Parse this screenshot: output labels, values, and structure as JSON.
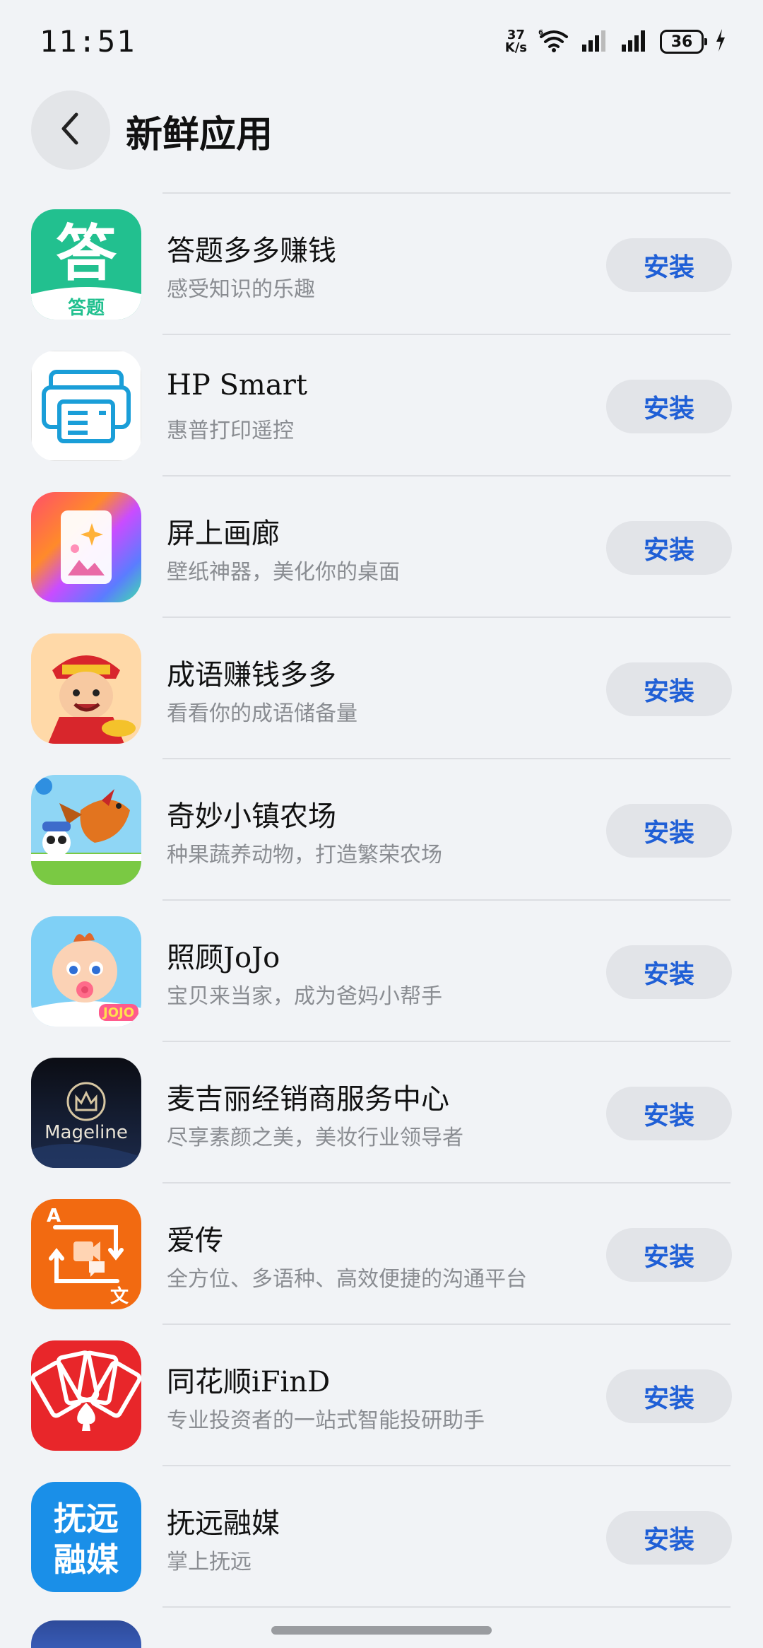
{
  "status_bar": {
    "time": "11:51",
    "net_speed_value": "37",
    "net_speed_unit": "K/s",
    "battery_level": "36"
  },
  "header": {
    "title": "新鲜应用"
  },
  "apps": [
    {
      "name": "答题多多赚钱",
      "desc": "感受知识的乐趣",
      "action": "安装",
      "icon": "quiz-app-icon",
      "icon_text": "答题"
    },
    {
      "name": "HP Smart",
      "desc": "惠普打印遥控",
      "action": "安装",
      "icon": "printer-app-icon"
    },
    {
      "name": "屏上画廊",
      "desc": "壁纸神器，美化你的桌面",
      "action": "安装",
      "icon": "gallery-app-icon"
    },
    {
      "name": "成语赚钱多多",
      "desc": "看看你的成语储备量",
      "action": "安装",
      "icon": "idiom-app-icon"
    },
    {
      "name": "奇妙小镇农场",
      "desc": "种果蔬养动物，打造繁荣农场",
      "action": "安装",
      "icon": "farm-app-icon"
    },
    {
      "name": "照顾JoJo",
      "desc": "宝贝来当家，成为爸妈小帮手",
      "action": "安装",
      "icon": "baby-app-icon",
      "icon_text": "JOJO"
    },
    {
      "name": "麦吉丽经销商服务中心",
      "desc": "尽享素颜之美，美妆行业领导者",
      "action": "安装",
      "icon": "mageline-app-icon",
      "icon_text": "Mageline"
    },
    {
      "name": "爱传",
      "desc": "全方位、多语种、高效便捷的沟通平台",
      "action": "安装",
      "icon": "translate-app-icon",
      "icon_text_a": "A",
      "icon_text_b": "文"
    },
    {
      "name": "同花顺iFinD",
      "desc": "专业投资者的一站式智能投研助手",
      "action": "安装",
      "icon": "cards-app-icon"
    },
    {
      "name": "抚远融媒",
      "desc": "掌上抚远",
      "action": "安装",
      "icon": "fuyuan-app-icon",
      "icon_text_a": "抚远",
      "icon_text_b": "融媒"
    }
  ]
}
